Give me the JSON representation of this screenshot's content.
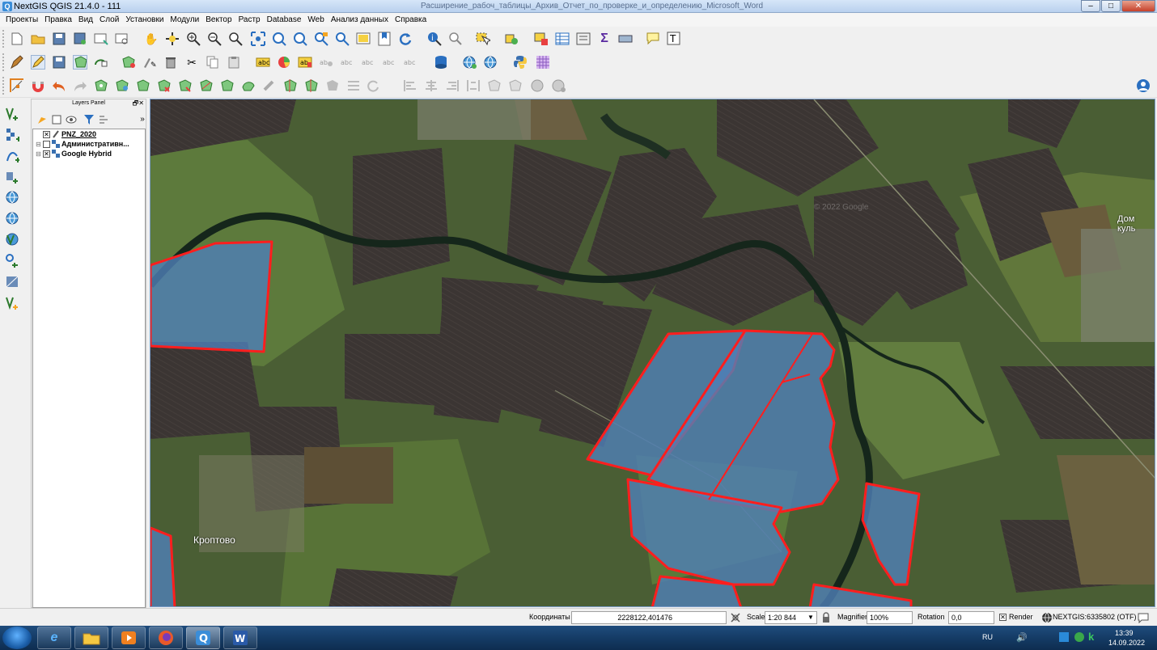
{
  "window": {
    "app_icon_letter": "Q",
    "title": "NextGIS QGIS 21.4.0 - 111",
    "background_title": "Расширение_рабоч_таблицы_Архив_Отчет_по_проверке_и_определению_Microsoft_Word",
    "min_label": "–",
    "max_label": "□",
    "close_label": "✕"
  },
  "menu": [
    "Проекты",
    "Правка",
    "Вид",
    "Слой",
    "Установки",
    "Модули",
    "Вектор",
    "Растр",
    "Database",
    "Web",
    "Анализ данных",
    "Справка"
  ],
  "layers_panel": {
    "title": "Layers Panel",
    "float_label": "🗗",
    "close_label": "✕",
    "more_label": "»",
    "layers": [
      {
        "name": "PNZ_2020",
        "checked": true,
        "expand_sign": ""
      },
      {
        "name": "Административн...",
        "checked": false,
        "expand_sign": "⊟"
      },
      {
        "name": "Google Hybrid",
        "checked": true,
        "expand_sign": "⊟"
      }
    ]
  },
  "map": {
    "places": [
      {
        "name": "Кроптово"
      },
      {
        "name": "Дом куль"
      }
    ],
    "watermark": "© 2022 Google"
  },
  "status": {
    "coord_label": "Координаты",
    "coord_value": "2228122,401476",
    "scale_label": "Scale",
    "scale_value": "1:20 844",
    "magnifier_label": "Magnifier",
    "magnifier_value": "100%",
    "rotation_label": "Rotation",
    "rotation_value": "0,0",
    "render_label": "Render",
    "crs_label": "NEXTGIS:6335802 (OTF)"
  },
  "taskbar": {
    "lang": "RU",
    "time": "13:39",
    "date": "14.09.2022"
  },
  "colors": {
    "parcel_fill": "#4f7fb8",
    "parcel_border": "#ff1e1e",
    "taskbar": "#1b4472"
  }
}
